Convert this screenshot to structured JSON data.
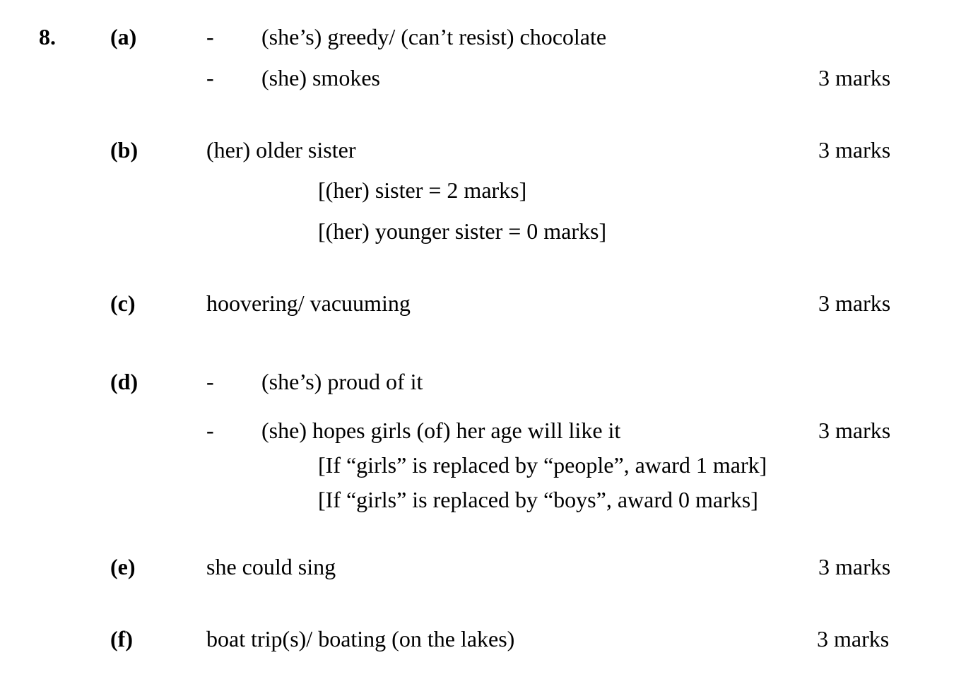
{
  "question": {
    "number": "8.",
    "parts": {
      "a": {
        "label": "(a)",
        "lines": [
          {
            "bullet": "-",
            "text": "(she’s) greedy/ (can’t resist) chocolate"
          },
          {
            "bullet": "-",
            "text": "(she) smokes"
          }
        ],
        "marks": "3 marks"
      },
      "b": {
        "label": "(b)",
        "answer": "(her) older sister",
        "marks": "3 marks",
        "notes": [
          "[(her) sister = 2 marks]",
          "[(her) younger sister = 0 marks]"
        ]
      },
      "c": {
        "label": "(c)",
        "answer": "hoovering/ vacuuming",
        "marks": "3 marks"
      },
      "d": {
        "label": "(d)",
        "lines": [
          {
            "bullet": "-",
            "text": "(she’s) proud of it"
          },
          {
            "bullet": "-",
            "text": "(she) hopes girls (of) her age will like it"
          }
        ],
        "marks": "3 marks",
        "notes": [
          "[If “girls” is replaced by “people”, award 1 mark]",
          "[If “girls” is replaced by “boys”, award 0 marks]"
        ]
      },
      "e": {
        "label": "(e)",
        "answer": "she could sing",
        "marks": "3 marks"
      },
      "f": {
        "label": "(f)",
        "answer": "boat trip(s)/ boating (on the lakes)",
        "marks": "3 marks"
      }
    }
  }
}
